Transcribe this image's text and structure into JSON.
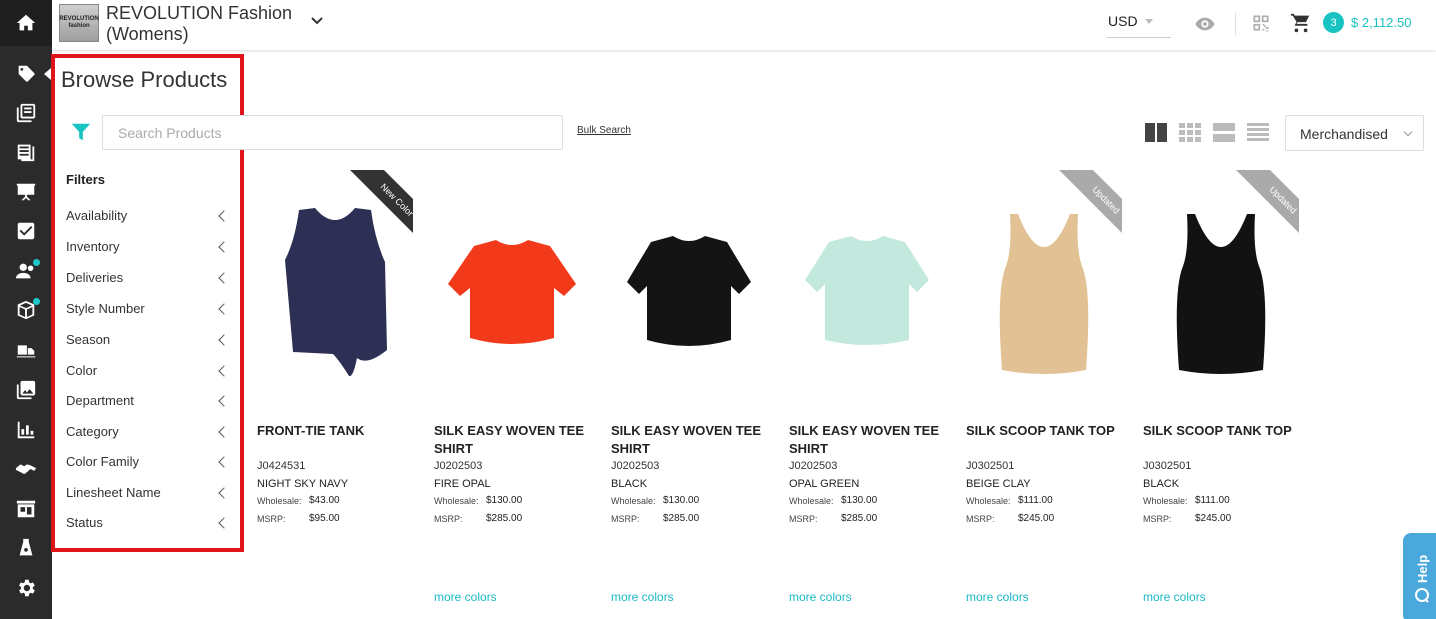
{
  "nav_rail": {
    "icons": [
      "home-icon",
      "tag-icon",
      "catalog-icon",
      "linesheet-icon",
      "presentation-icon",
      "checklist-icon",
      "customers-icon",
      "orders-icon",
      "deliveries-icon",
      "images-icon",
      "reports-icon",
      "partners-icon",
      "showroom-icon",
      "brand-icon",
      "settings-icon"
    ]
  },
  "header": {
    "brand_logo_line1": "REVOLUTION",
    "brand_logo_line2": "fashion",
    "brand_name": "REVOLUTION Fashion (Womens)",
    "currency": "USD",
    "cart_count": "3",
    "cart_total": "$ 2,112.50"
  },
  "browse": {
    "title": "Browse Products",
    "search_placeholder": "Search Products",
    "bulk_search": "Bulk Search",
    "filters_heading": "Filters",
    "filters": [
      "Availability",
      "Inventory",
      "Deliveries",
      "Style Number",
      "Season",
      "Color",
      "Department",
      "Category",
      "Color Family",
      "Linesheet Name",
      "Status"
    ],
    "sort": "Merchandised"
  },
  "products": [
    {
      "name": "FRONT-TIE TANK",
      "style": "J0424531",
      "color": "NIGHT SKY NAVY",
      "wholesale_label": "Wholesale:",
      "wholesale": "$43.00",
      "msrp_label": "MSRP:",
      "msrp": "$95.00",
      "ribbon": "New Color",
      "more": "",
      "swatch": "#2e2f55"
    },
    {
      "name": "SILK EASY WOVEN TEE SHIRT",
      "style": "J0202503",
      "color": "FIRE OPAL",
      "wholesale_label": "Wholesale:",
      "wholesale": "$130.00",
      "msrp_label": "MSRP:",
      "msrp": "$285.00",
      "ribbon": "",
      "more": "more colors",
      "swatch": "#f23a1a"
    },
    {
      "name": "SILK EASY WOVEN TEE SHIRT",
      "style": "J0202503",
      "color": "BLACK",
      "wholesale_label": "Wholesale:",
      "wholesale": "$130.00",
      "msrp_label": "MSRP:",
      "msrp": "$285.00",
      "ribbon": "",
      "more": "more colors",
      "swatch": "#141414"
    },
    {
      "name": "SILK EASY WOVEN TEE SHIRT",
      "style": "J0202503",
      "color": "OPAL GREEN",
      "wholesale_label": "Wholesale:",
      "wholesale": "$130.00",
      "msrp_label": "MSRP:",
      "msrp": "$285.00",
      "ribbon": "",
      "more": "more colors",
      "swatch": "#c3e9df"
    },
    {
      "name": "SILK SCOOP TANK TOP",
      "style": "J0302501",
      "color": "BEIGE CLAY",
      "wholesale_label": "Wholesale:",
      "wholesale": "$111.00",
      "msrp_label": "MSRP:",
      "msrp": "$245.00",
      "ribbon": "Updated",
      "more": "more colors",
      "swatch": "#e2c294"
    },
    {
      "name": "SILK SCOOP TANK TOP",
      "style": "J0302501",
      "color": "BLACK",
      "wholesale_label": "Wholesale:",
      "wholesale": "$111.00",
      "msrp_label": "MSRP:",
      "msrp": "$245.00",
      "ribbon": "Updated",
      "more": "more colors",
      "swatch": "#121212"
    }
  ],
  "help": "Help",
  "colors": {
    "accent": "#19c3c1",
    "panel_outline": "#e0141b",
    "rail": "#2b2b2b",
    "link": "#19b9c6"
  }
}
